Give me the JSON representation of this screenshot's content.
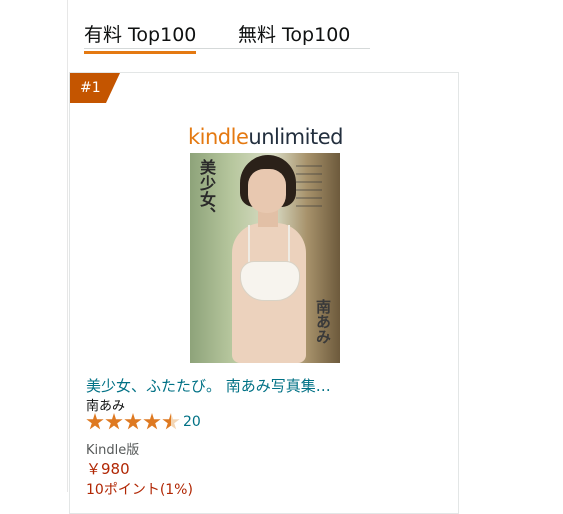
{
  "tabs": [
    {
      "label": "有料 Top100",
      "active": true
    },
    {
      "label": "無料 Top100",
      "active": false
    }
  ],
  "colors": {
    "accent_orange": "#e47911",
    "rank_badge": "#c45500",
    "link_teal": "#007185",
    "price_red": "#b12704",
    "star": "#de7921"
  },
  "product": {
    "rank": "#1",
    "cover": {
      "brand_kindle": "kindle",
      "brand_unlimited": "unlimited",
      "title_vertical": "美少女、",
      "name_vertical": "南あみ"
    },
    "title": "美少女、ふたたび。 南あみ写真集…",
    "author": "南あみ",
    "rating": 4.5,
    "review_count": "20",
    "format": "Kindle版",
    "price": "￥980",
    "points": "10ポイント(1%)"
  }
}
